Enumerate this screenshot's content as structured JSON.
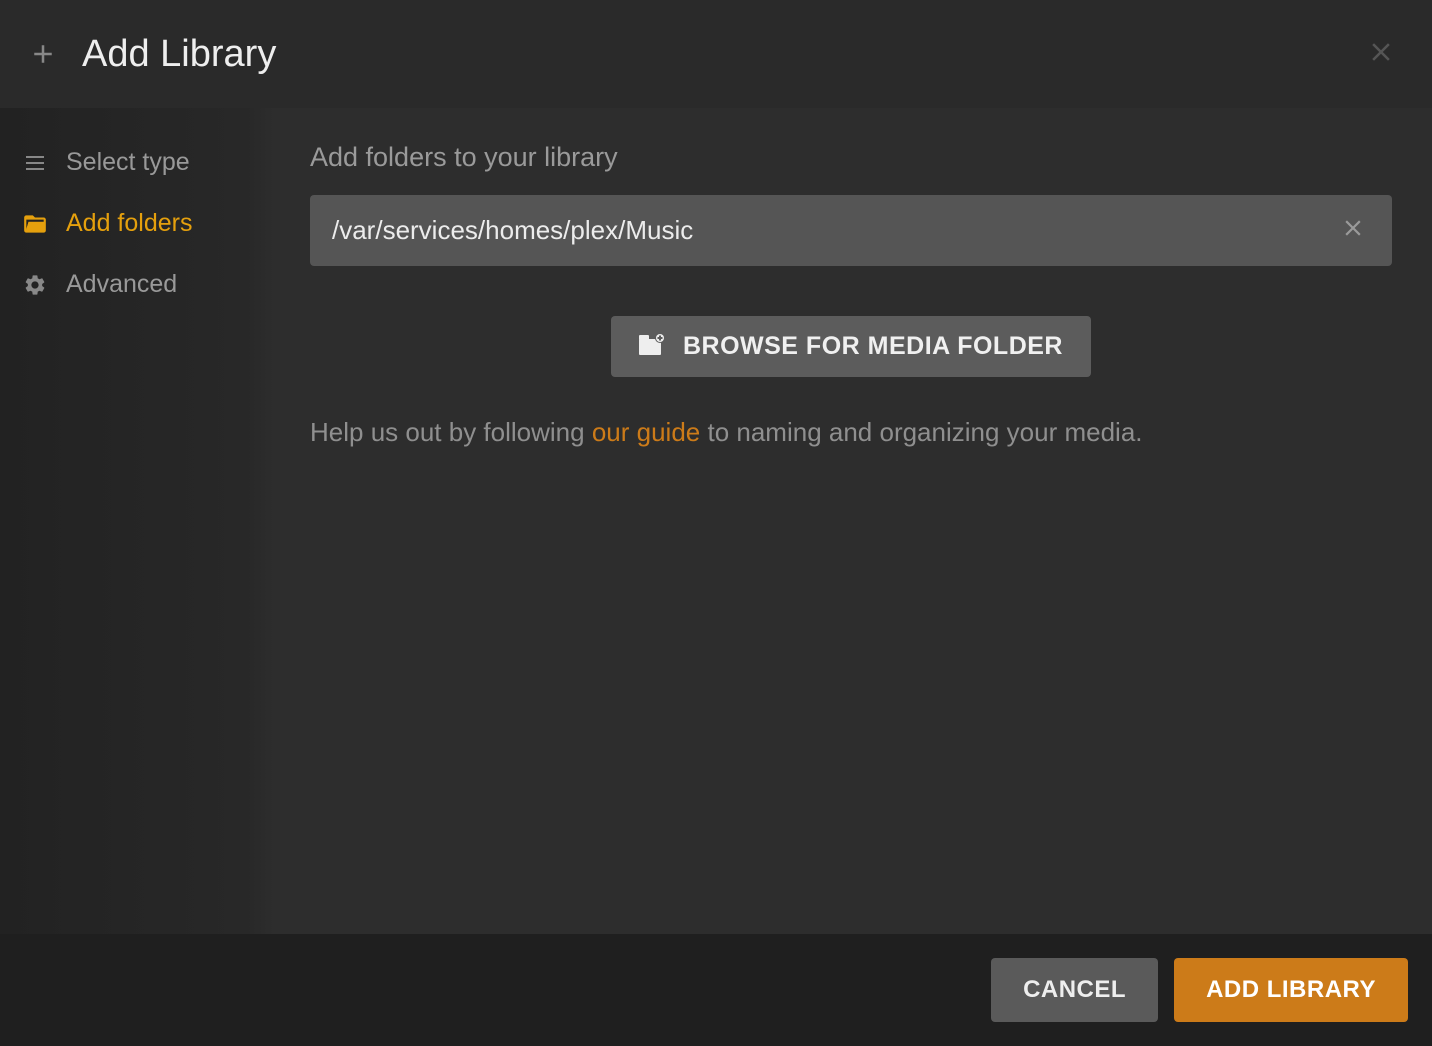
{
  "header": {
    "title": "Add Library"
  },
  "sidebar": {
    "items": [
      {
        "label": "Select type"
      },
      {
        "label": "Add folders"
      },
      {
        "label": "Advanced"
      }
    ]
  },
  "main": {
    "heading": "Add folders to your library",
    "folder_path": "/var/services/homes/plex/Music",
    "browse_label": "BROWSE FOR MEDIA FOLDER",
    "help_prefix": "Help us out by following ",
    "help_link": "our guide",
    "help_suffix": " to naming and organizing your media."
  },
  "footer": {
    "cancel_label": "CANCEL",
    "add_label": "ADD LIBRARY"
  }
}
